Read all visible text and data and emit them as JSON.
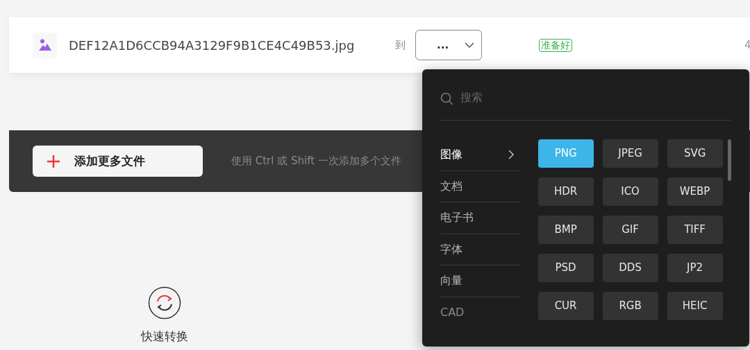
{
  "file_row": {
    "file_name": "DEF12A1D6CCB94A3129F9B1CE4C49B53.jpg",
    "to_label": "到",
    "format_select": {
      "value": "..."
    },
    "status_badge": "准备好",
    "column_5": "4"
  },
  "add_bar": {
    "button": "添加更多文件",
    "hint": "使用 Ctrl 或 Shift 一次添加多个文件"
  },
  "features": [
    {
      "label": "快速转换"
    }
  ],
  "dropdown": {
    "search": {
      "placeholder": "搜索"
    },
    "categories": [
      {
        "label": "图像",
        "selected": true,
        "disabled": false
      },
      {
        "label": "文档",
        "selected": false,
        "disabled": false
      },
      {
        "label": "电子书",
        "selected": false,
        "disabled": false
      },
      {
        "label": "字体",
        "selected": false,
        "disabled": false
      },
      {
        "label": "向量",
        "selected": false,
        "disabled": false
      },
      {
        "label": "CAD",
        "selected": false,
        "disabled": true
      }
    ],
    "formats": [
      {
        "label": "PNG",
        "selected": true
      },
      {
        "label": "JPEG",
        "selected": false
      },
      {
        "label": "SVG",
        "selected": false
      },
      {
        "label": "HDR",
        "selected": false
      },
      {
        "label": "ICO",
        "selected": false
      },
      {
        "label": "WEBP",
        "selected": false
      },
      {
        "label": "BMP",
        "selected": false
      },
      {
        "label": "GIF",
        "selected": false
      },
      {
        "label": "TIFF",
        "selected": false
      },
      {
        "label": "PSD",
        "selected": false
      },
      {
        "label": "DDS",
        "selected": false
      },
      {
        "label": "JP2",
        "selected": false
      },
      {
        "label": "CUR",
        "selected": false
      },
      {
        "label": "RGB",
        "selected": false
      },
      {
        "label": "HEIC",
        "selected": false
      }
    ]
  }
}
